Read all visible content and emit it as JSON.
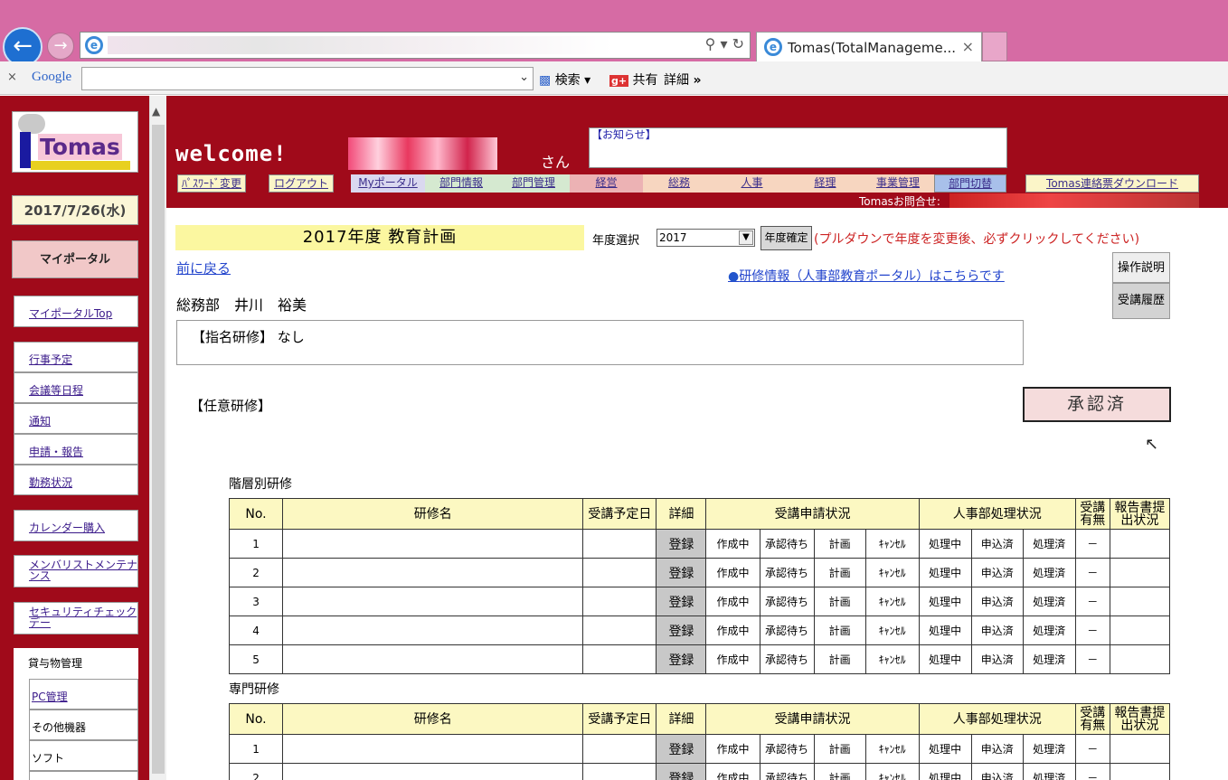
{
  "browser": {
    "tab_title": "Tomas(TotalManageme...",
    "tab_close": "×",
    "toolbar_close": "×",
    "google": "Google",
    "search_label": "検索",
    "share_label": "共有",
    "detail_label": "詳細",
    "more": "»"
  },
  "sidebar": {
    "logo_text": "Tomas",
    "date": "2017/7/26(水)",
    "my_portal": "マイポータル",
    "groups": [
      {
        "items": [
          "マイポータルTop"
        ]
      },
      {
        "items": [
          "行事予定",
          "会議等日程",
          "通知",
          "申請・報告",
          "勤務状況"
        ]
      },
      {
        "items": [
          "カレンダー購入"
        ]
      },
      {
        "items": [
          "メンバリストメンテナンス"
        ]
      },
      {
        "items": [
          "セキュリティチェックデー"
        ]
      }
    ],
    "rental_title": "貸与物管理",
    "rental_items": [
      "PC管理",
      "その他機器",
      "ソフト"
    ]
  },
  "header": {
    "welcome": "welcome!",
    "san": "さん",
    "notice": "【お知らせ】",
    "nav": [
      "ﾊﾟｽﾜｰﾄﾞ変更",
      "ログアウト",
      "Myポータル",
      "部門情報",
      "部門管理",
      "経営",
      "総務",
      "人事",
      "経理",
      "事業管理",
      "部門切替",
      "Tomas連絡票ダウンロード"
    ],
    "contact": "Tomasお問合せ:"
  },
  "main": {
    "title": "2017年度 教育計画",
    "year_label": "年度選択",
    "year_value": "2017",
    "year_button": "年度確定",
    "year_note": "(プルダウンで年度を変更後、必ずクリックしてください)",
    "back_link": "前に戻る",
    "training_link": "研修情報（人事部教育ポータル）はこちらです",
    "help_button": "操作説明",
    "history_button": "受講履歴",
    "department": "総務部　井川　裕美",
    "designated": "【指名研修】 なし",
    "optional": "【任意研修】",
    "approval": "承認済"
  },
  "tables": {
    "headers": [
      "No.",
      "研修名",
      "受講予定日",
      "詳細",
      "受講申請状況",
      "人事部処理状況",
      "受講有無",
      "報告書提出状況"
    ],
    "row_cells": [
      "登録",
      "作成中",
      "承認待ち",
      "計画",
      "ｷｬﾝｾﾙ",
      "処理中",
      "申込済",
      "処理済",
      "－"
    ],
    "sections": [
      {
        "title": "階層別研修",
        "rows": [
          "1",
          "2",
          "3",
          "4",
          "5"
        ]
      },
      {
        "title": "専門研修",
        "rows": [
          "1",
          "2"
        ]
      }
    ]
  }
}
